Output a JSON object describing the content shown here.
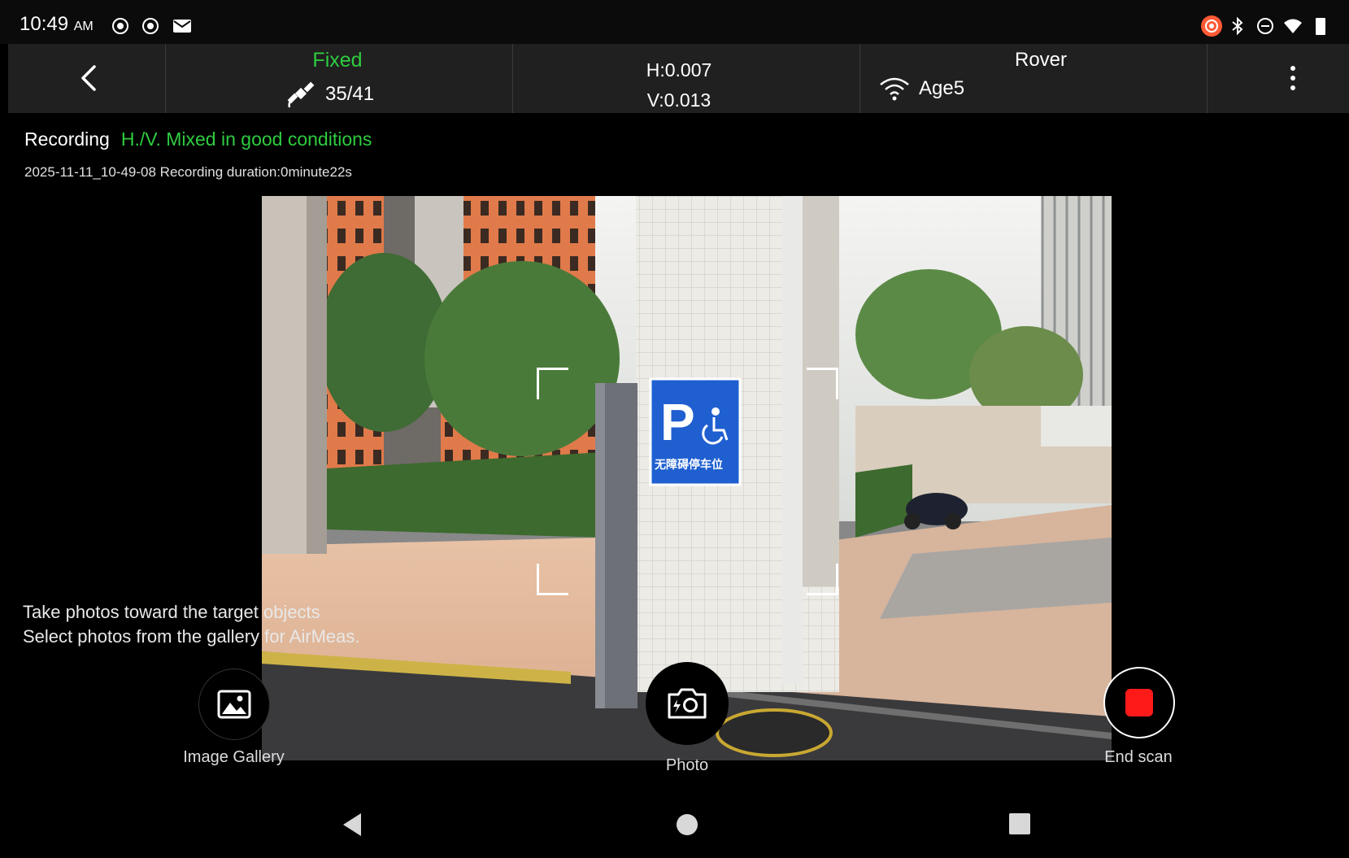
{
  "status_bar": {
    "time": "10:49",
    "ampm": "AM"
  },
  "toolbar": {
    "fix_status": "Fixed",
    "satellites": "35/41",
    "h_precision": "H:0.007",
    "v_precision": "V:0.013",
    "mode": "Rover",
    "age": "Age5"
  },
  "recording": {
    "label": "Recording",
    "quality": "H./V. Mixed in good conditions",
    "meta": "2025-11-11_10-49-08 Recording duration:0minute22s"
  },
  "hints": {
    "line1": "Take photos toward the target objects",
    "line2": "Select photos from the gallery for AirMeas."
  },
  "controls": {
    "gallery_label": "Image Gallery",
    "photo_label": "Photo",
    "end_label": "End scan"
  },
  "camera": {
    "sign_letter": "P",
    "sign_text": "无障碍停车位"
  },
  "colors": {
    "fixed_green": "#2ecc40",
    "record_red": "#ff1a1a",
    "toolbar_bg": "#202020",
    "sign_blue": "#1f5fd0"
  }
}
